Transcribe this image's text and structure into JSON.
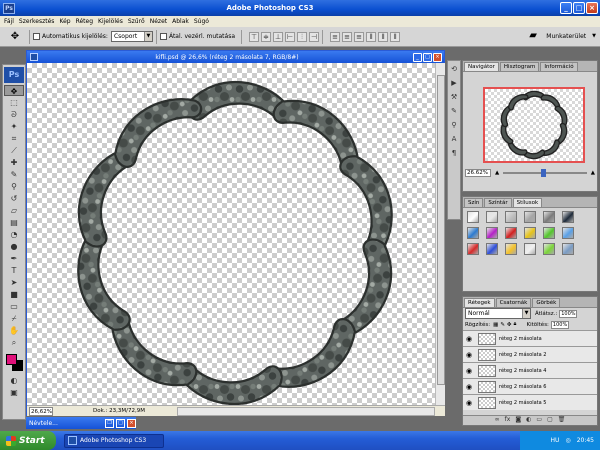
{
  "window": {
    "title": "Adobe Photoshop CS3",
    "app_icon": "Ps"
  },
  "menu": [
    "Fájl",
    "Szerkesztés",
    "Kép",
    "Réteg",
    "Kijelölés",
    "Szűrő",
    "Nézet",
    "Ablak",
    "Súgó"
  ],
  "options": {
    "auto_select_label": "Automatikus kijelölés:",
    "auto_select_value": "Csoport",
    "transform_label": "Átal. vezérl. mutatása",
    "workspace_label": "Munkaterület"
  },
  "toolbox": {
    "logo": "Ps"
  },
  "document": {
    "title": "kifli.psd @ 26,6% (réteg 2 másolata 7, RGB/8#)",
    "zoom": "26,62%",
    "doc_size": "Dok.: 23,3M/72,9M"
  },
  "navigator": {
    "tabs": [
      "Navigátor",
      "Hisztogram",
      "Információ"
    ],
    "zoom": "26.62%"
  },
  "styles": {
    "tabs": [
      "Szín",
      "Színtár",
      "Stílusok"
    ],
    "swatch_colors": [
      "#ffffff",
      "#e6e6e6",
      "#bfbfbf",
      "#a5a5a5",
      "#7a7a7a",
      "#1f2b3a",
      "#2c7bd0",
      "#b521c7",
      "#d22020",
      "#e6c319",
      "#53c62b",
      "#5aa0e6",
      "#d62a2a",
      "#2f4fd8",
      "#f4c22b",
      "#f0f0f0",
      "#7bd43a",
      "#7a9cc4"
    ]
  },
  "layers": {
    "tabs": [
      "Rétegek",
      "Csatornák",
      "Görbék"
    ],
    "blend_mode": "Normál",
    "opacity_label": "Átlátsz.:",
    "opacity": "100%",
    "lock_label": "Rögzítés:",
    "fill_label": "Kitöltés:",
    "fill": "100%",
    "items": [
      "réteg 2 másolata",
      "réteg 2 másolata 2",
      "réteg 2 másolata 4",
      "réteg 2 másolata 6",
      "réteg 2 másolata 5"
    ]
  },
  "minimized": {
    "title": "Névtele..."
  },
  "taskbar": {
    "start": "Start",
    "task": "Adobe Photoshop CS3",
    "lang": "HU",
    "time": "20:45"
  },
  "colors": {
    "foreground": "#e0107a",
    "background": "#000000"
  }
}
